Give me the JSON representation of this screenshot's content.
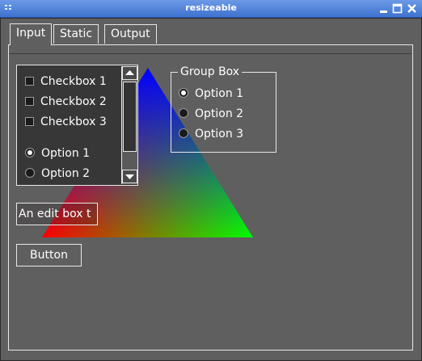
{
  "window": {
    "title": "resizeable"
  },
  "tabs": [
    {
      "label": "Input",
      "active": true
    },
    {
      "label": "Static",
      "active": false
    },
    {
      "label": "Output",
      "active": false
    }
  ],
  "listbox": {
    "items": [
      {
        "type": "checkbox",
        "label": "Checkbox 1",
        "checked": false
      },
      {
        "type": "checkbox",
        "label": "Checkbox 2",
        "checked": false
      },
      {
        "type": "checkbox",
        "label": "Checkbox 3",
        "checked": false
      },
      {
        "type": "radio",
        "label": "Option 1",
        "selected": true
      },
      {
        "type": "radio",
        "label": "Option 2",
        "selected": false
      }
    ]
  },
  "group_box": {
    "title": "Group Box",
    "options": [
      {
        "label": "Option 1",
        "selected": true
      },
      {
        "label": "Option 2",
        "selected": false
      },
      {
        "label": "Option 3",
        "selected": false
      }
    ]
  },
  "edit_box": {
    "value": "An edit box t"
  },
  "button": {
    "label": "Button"
  },
  "colors": {
    "background": "#5f5f5f",
    "titlebar": "#4f82dc",
    "triangle_top": "#0000ff",
    "triangle_left": "#ff0000",
    "triangle_right": "#00ff00"
  },
  "icons": {
    "window_menu": "grip-icon",
    "minimize": "minimize-icon",
    "maximize": "maximize-icon",
    "close": "close-icon",
    "scroll_up": "arrow-up-icon",
    "scroll_down": "arrow-down-icon"
  }
}
